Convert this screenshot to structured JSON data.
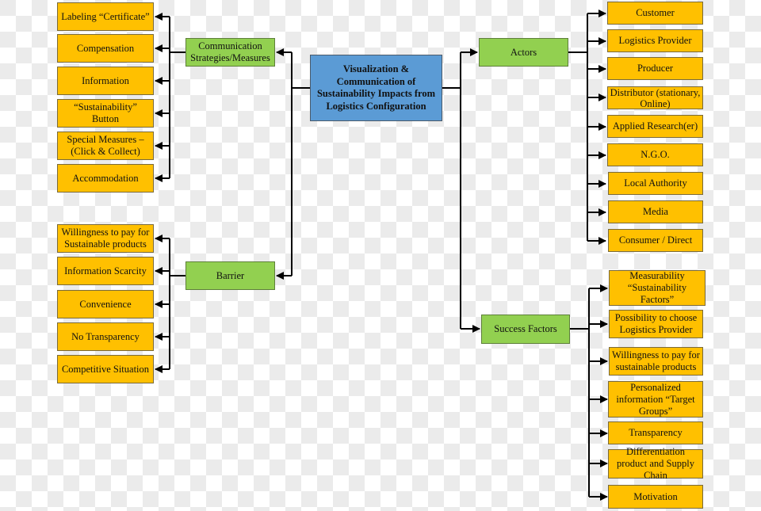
{
  "root": {
    "label": "Visualization & Communication of Sustainability Impacts from Logistics Configuration"
  },
  "colors": {
    "leaf": "#ffc000",
    "category": "#92d050",
    "root": "#5b9bd5",
    "connector": "#000000"
  },
  "categories": {
    "communication": {
      "label": "Communication Strategies/Measures",
      "items": [
        "Labeling “Certificate”",
        "Compensation",
        "Information",
        "“Sustainability” Button",
        "Special Measures – (Click & Collect)",
        "Accommodation"
      ]
    },
    "barrier": {
      "label": "Barrier",
      "items": [
        "Willingness to pay for Sustainable products",
        "Information Scarcity",
        "Convenience",
        "No Transparency",
        "Competitive Situation"
      ]
    },
    "actors": {
      "label": "Actors",
      "items": [
        "Customer",
        "Logistics Provider",
        "Producer",
        "Distributor (stationary, Online)",
        "Applied Research(er)",
        "N.G.O.",
        "Local Authority",
        "Media",
        "Consumer / Direct"
      ]
    },
    "success": {
      "label": "Success Factors",
      "items": [
        "Measurability “Sustainability Factors”",
        "Possibility to choose Logistics Provider",
        "Willingness to pay for sustainable products",
        "Personalized information “Target Groups”",
        "Transparency",
        "Differentiation product and Supply Chain",
        "Motivation"
      ]
    }
  }
}
